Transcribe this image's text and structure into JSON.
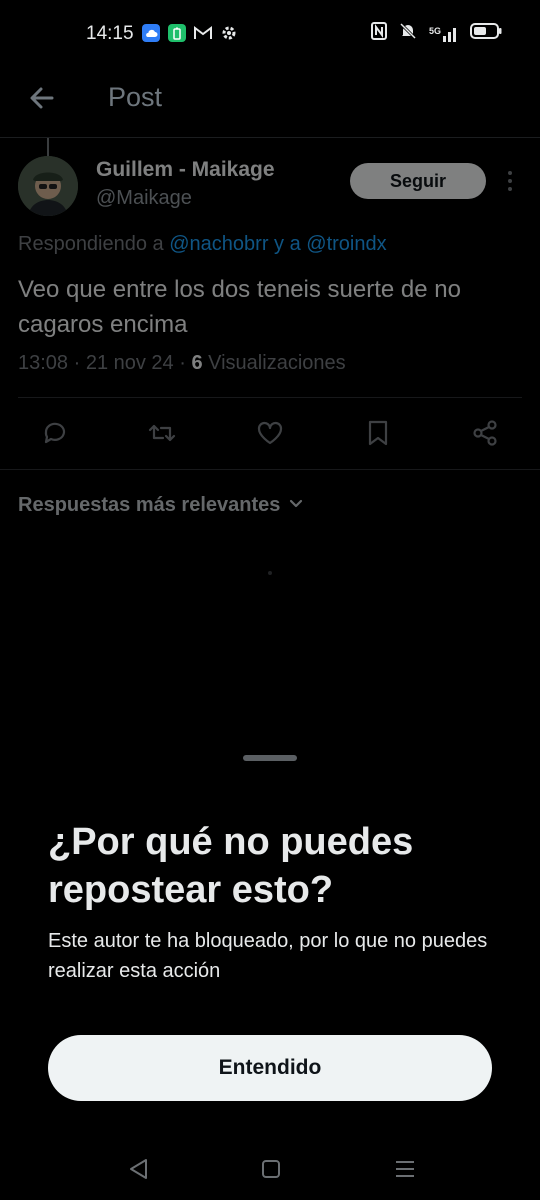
{
  "status_bar": {
    "time": "14:15",
    "network": "5G"
  },
  "header": {
    "title": "Post"
  },
  "tweet": {
    "author_name": "Guillem - Maikage",
    "author_handle": "@Maikage",
    "follow_label": "Seguir",
    "replying_prefix": "Respondiendo a ",
    "replying_mention1": "@nachobrr",
    "replying_conjunction": " y a ",
    "replying_mention2": "@troindx",
    "text": "Veo que entre los dos teneis suerte de no cagaros encima",
    "timestamp": "13:08 · 21 nov 24 · ",
    "views_count": "6",
    "views_label": " Visualizaciones"
  },
  "replies": {
    "sort_label": "Respuestas más relevantes"
  },
  "sheet": {
    "title": "¿Por qué no puedes repostear esto?",
    "body": "Este autor te ha bloqueado, por lo que no puedes realizar esta acción",
    "button_label": "Entendido"
  },
  "colors": {
    "background": "#000000",
    "accent": "#1d9bf0",
    "text": "#e7e9ea",
    "muted": "#71767b",
    "button_bg": "#eff3f4"
  },
  "icons": {
    "back": "arrow-left-icon",
    "more": "more-vertical-icon",
    "reply": "reply-icon",
    "repost": "repost-icon",
    "like": "heart-icon",
    "bookmark": "bookmark-icon",
    "share": "share-icon"
  }
}
